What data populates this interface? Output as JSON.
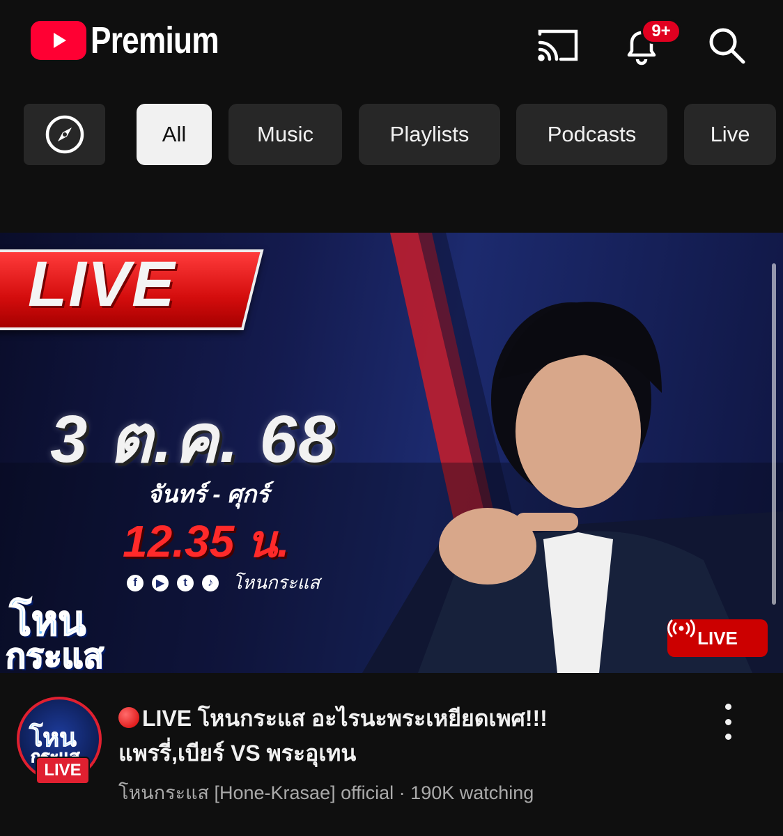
{
  "app": {
    "brand": "Premium",
    "icons": {
      "logo": "youtube-play-icon",
      "cast": "cast-icon",
      "notifications": "bell-icon",
      "search": "search-icon"
    },
    "notification_badge": "9+",
    "accent": "#ff0033"
  },
  "chips": {
    "explore_icon": "compass-icon",
    "items": [
      {
        "label": "All",
        "selected": true
      },
      {
        "label": "Music",
        "selected": false
      },
      {
        "label": "Playlists",
        "selected": false
      },
      {
        "label": "Podcasts",
        "selected": false
      },
      {
        "label": "Live",
        "selected": false
      }
    ]
  },
  "video": {
    "thumbnail": {
      "banner": "LIVE",
      "date": "3 ต.ค. 68",
      "days": "จันทร์ - ศุกร์",
      "time": "12.35 น.",
      "social_name": "โหนกระแส",
      "show_logo_top": "โหน",
      "show_logo_bottom": "กระแส",
      "live_tag": "LIVE"
    },
    "title_line1": "LIVE โหนกระแส อะไรนะพระเหยียดเพศ!!!",
    "title_line2": "แพรรี่,เบียร์ VS พระอุเทน",
    "channel": "โหนกระแส [Hone-Krasae] official",
    "separator": "·",
    "viewers": "190K watching",
    "avatar_live": "LIVE",
    "avatar_logo_top": "โหน",
    "avatar_logo_bottom": "กระแส"
  }
}
